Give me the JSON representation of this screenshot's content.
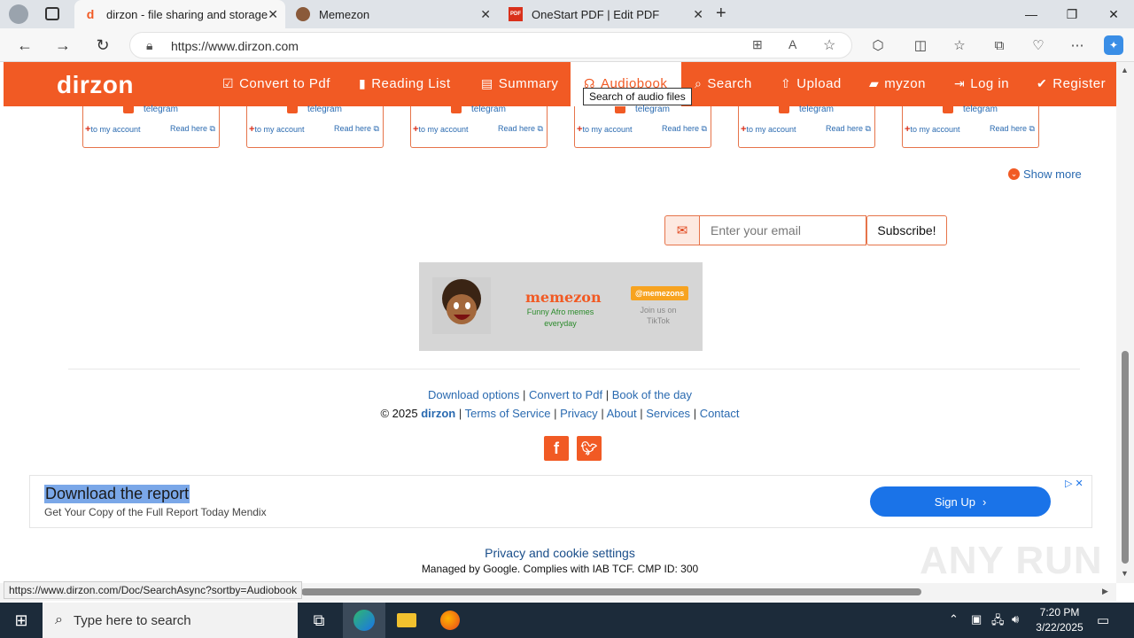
{
  "browser": {
    "tabs": [
      {
        "title": "dirzon - file sharing and storage",
        "favicon": "d"
      },
      {
        "title": "Memezon",
        "favicon": "face"
      },
      {
        "title": "OneStart PDF | Edit PDF",
        "favicon": "PDF"
      }
    ],
    "url": "https://www.dirzon.com",
    "status_url": "https://www.dirzon.com/Doc/SearchAsync?sortby=Audiobook"
  },
  "site": {
    "logo": "dirzon",
    "nav": [
      {
        "label": "Convert to Pdf",
        "icon": "check-square-icon"
      },
      {
        "label": "Reading List",
        "icon": "bar-chart-icon"
      },
      {
        "label": "Summary",
        "icon": "list-icon"
      },
      {
        "label": "Audiobook",
        "icon": "headphones-icon"
      },
      {
        "label": "Search",
        "icon": "search-icon"
      },
      {
        "label": "Upload",
        "icon": "upload-icon"
      },
      {
        "label": "myzon",
        "icon": "folder-icon"
      },
      {
        "label": "Log in",
        "icon": "login-icon"
      },
      {
        "label": "Register",
        "icon": "check-circle-icon"
      }
    ],
    "tooltip": "Search of audio files",
    "cards": [
      {
        "source": "telegram",
        "add": "to my account",
        "read": "Read here"
      },
      {
        "source": "telegram",
        "add": "to my account",
        "read": "Read here"
      },
      {
        "source": "telegram",
        "add": "to my account",
        "read": "Read here"
      },
      {
        "source": "telegram",
        "add": "to my account",
        "read": "Read here"
      },
      {
        "source": "telegram",
        "add": "to my account",
        "read": "Read here"
      },
      {
        "source": "telegram",
        "add": "to my account",
        "read": "Read here"
      }
    ],
    "show_more": "Show more",
    "subscribe": {
      "placeholder": "Enter your email",
      "button": "Subscribe!"
    },
    "banner": {
      "title": "memezon",
      "subtitle": "Funny Afro memes everyday",
      "handle": "@memezons",
      "join": "Join us on TikTok"
    },
    "footer": {
      "links1": [
        "Download options",
        "Convert to Pdf",
        "Book of the day"
      ],
      "copyright": "© 2025",
      "logo": "dirzon",
      "links2": [
        "Terms of Service",
        "Privacy",
        "About",
        "Services",
        "Contact"
      ]
    },
    "ad": {
      "title": "Download the report",
      "desc": "Get Your Copy of the Full Report Today Mendix",
      "button": "Sign Up"
    },
    "privacy": {
      "title": "Privacy and cookie settings",
      "sub": "Managed by Google. Complies with IAB TCF. CMP ID: 300"
    },
    "watermark": "ANY RUN"
  },
  "taskbar": {
    "search_placeholder": "Type here to search",
    "time": "7:20 PM",
    "date": "3/22/2025"
  },
  "colors": {
    "brand": "#f15a24",
    "link": "#2a6ab0"
  }
}
